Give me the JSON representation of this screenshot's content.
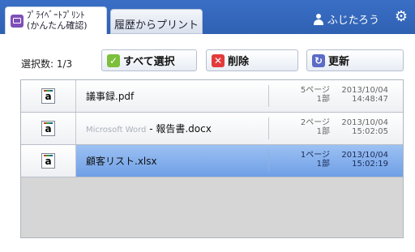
{
  "tabs": [
    {
      "label_line1": "ﾌﾟﾗｲﾍﾞｰﾄﾌﾟﾘﾝﾄ",
      "label_line2": "(かんたん確認)",
      "active": true
    },
    {
      "label": "履歴からプリント",
      "active": false
    }
  ],
  "user": {
    "name": "ふじたろう"
  },
  "icons": {
    "tab": "private-print-icon",
    "user": "user-icon",
    "settings": "gear-icon",
    "select": "check-icon",
    "delete": "x-icon",
    "refresh": "refresh-icon",
    "file": "document-icon"
  },
  "toolbar": {
    "selected_count": "選択数: 1/3",
    "select_all_label": "すべて選択",
    "delete_label": "削除",
    "refresh_label": "更新"
  },
  "jobs": [
    {
      "name": "議事録.pdf",
      "app_prefix": "",
      "pages": "5ページ",
      "copies": "1部",
      "date": "2013/10/04",
      "time": "14:48:47",
      "selected": false
    },
    {
      "name": "- 報告書.docx",
      "app_prefix": "Microsoft Word",
      "pages": "2ページ",
      "copies": "1部",
      "date": "2013/10/04",
      "time": "15:02:05",
      "selected": false
    },
    {
      "name": "顧客リスト.xlsx",
      "app_prefix": "",
      "pages": "1ページ",
      "copies": "1部",
      "date": "2013/10/04",
      "time": "15:02:19",
      "selected": true
    }
  ],
  "colors": {
    "header": "#2e5fb0",
    "selected_row": "#6f9fe6",
    "check": "#7cbf3a",
    "delete": "#e33b3b",
    "refresh": "#5b6bc6"
  }
}
